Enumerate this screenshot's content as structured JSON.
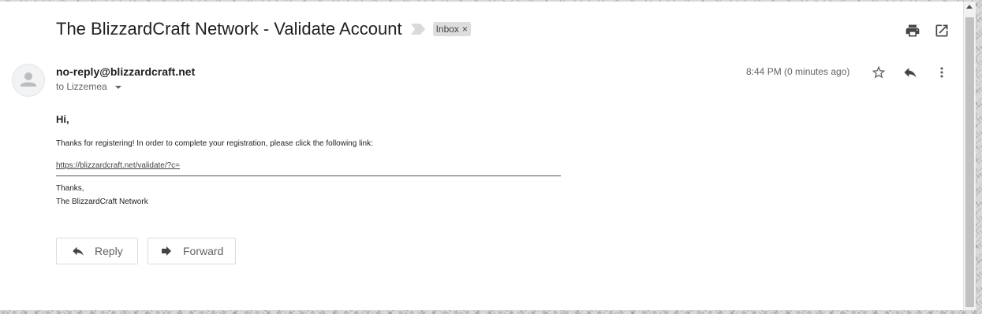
{
  "email": {
    "subject": "The BlizzardCraft Network - Validate Account",
    "label": "Inbox",
    "label_remove": "×",
    "sender": "no-reply@blizzardcraft.net",
    "recipient": "to Lizzemea",
    "timestamp": "8:44 PM (0 minutes ago)",
    "body": {
      "greeting": "Hi,",
      "message": "Thanks for registering! In order to complete your registration, please click the following link:",
      "link": "https://blizzardcraft.net/validate/?c=",
      "signoff": "Thanks,",
      "signature": "The BlizzardCraft Network"
    }
  },
  "actions": {
    "reply_label": "Reply",
    "forward_label": "Forward"
  },
  "icons": {
    "print": "print-icon",
    "open_new_window": "open-in-new-icon",
    "star": "star-icon",
    "reply": "reply-icon",
    "more": "more-vert-icon",
    "forward": "forward-icon",
    "avatar": "avatar-icon",
    "importance": "importance-marker-icon"
  }
}
